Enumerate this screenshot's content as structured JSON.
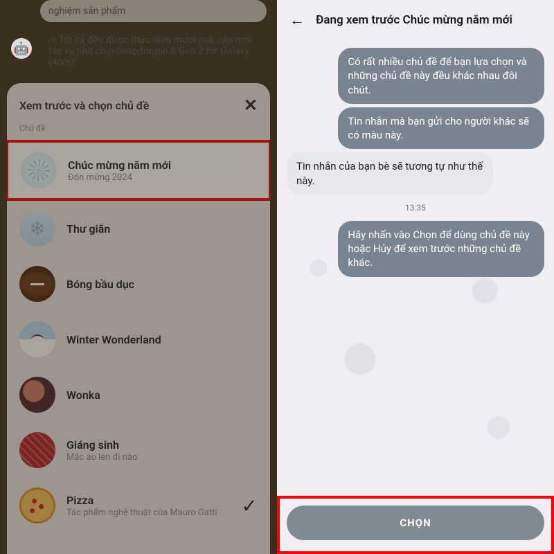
{
  "left": {
    "bg_message_line1": "nghiệm sản phẩm",
    "bg_message_line2": "-> Tất cả đều được thực hiện mượt mà, cân mọi tác vụ nhờ chip Snapdragon 8 Gen 2 for Galaxy (4nm)\"",
    "sheet_title": "Xem trước và chọn chủ đề",
    "section_label": "Chủ đề",
    "themes": [
      {
        "title": "Chúc mừng năm mới",
        "sub": "Đón mừng 2024"
      },
      {
        "title": "Thư giãn",
        "sub": ""
      },
      {
        "title": "Bóng bầu dục",
        "sub": ""
      },
      {
        "title": "Winter Wonderland",
        "sub": ""
      },
      {
        "title": "Wonka",
        "sub": ""
      },
      {
        "title": "Giáng sinh",
        "sub": "Mặc áo len đi nào"
      },
      {
        "title": "Pizza",
        "sub": "Tác phẩm nghệ thuật của Mauro Gatti"
      }
    ]
  },
  "right": {
    "header_title": "Đang xem trước Chúc mừng năm mới",
    "sent1": "Có rất nhiều chủ đề để bạn lựa chọn và những chủ đề này đều khác nhau đôi chút.",
    "sent2": "Tin nhắn mà bạn gửi cho người khác sẽ có màu này.",
    "recv1": "Tin nhắn của bạn bè sẽ tương tự như thế này.",
    "timestamp": "13:35",
    "sent3": "Hãy nhấn vào Chọn để dùng chủ đề này hoặc Hủy để xem trước những chủ đề khác.",
    "select_label": "CHỌN"
  }
}
